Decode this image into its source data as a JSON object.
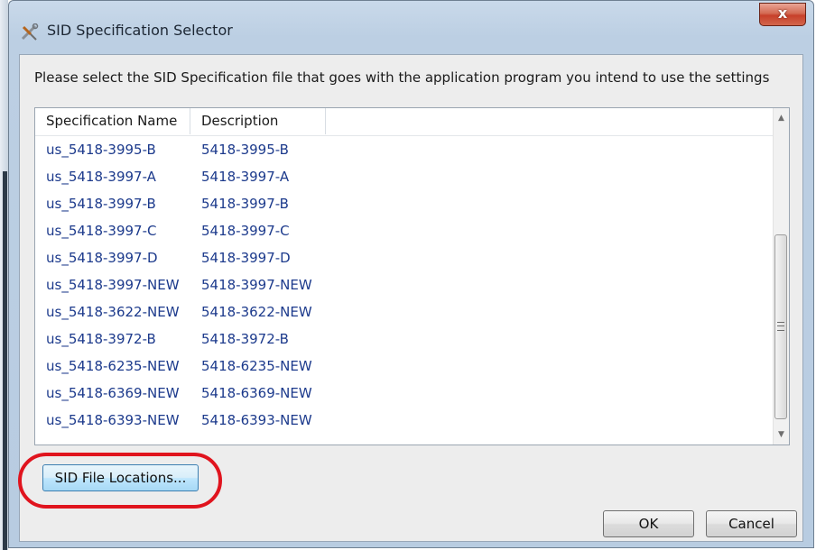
{
  "window": {
    "title": "SID Specification Selector",
    "close_label": "x"
  },
  "instruction": "Please select the SID Specification file that goes with the application program you intend to use the settings",
  "list": {
    "columns": [
      "Specification Name",
      "Description"
    ],
    "rows": [
      {
        "name": "us_5418-3995-B",
        "description": "5418-3995-B"
      },
      {
        "name": "us_5418-3997-A",
        "description": "5418-3997-A"
      },
      {
        "name": "us_5418-3997-B",
        "description": "5418-3997-B"
      },
      {
        "name": "us_5418-3997-C",
        "description": "5418-3997-C"
      },
      {
        "name": "us_5418-3997-D",
        "description": "5418-3997-D"
      },
      {
        "name": "us_5418-3997-NEW",
        "description": "5418-3997-NEW"
      },
      {
        "name": "us_5418-3622-NEW",
        "description": "5418-3622-NEW"
      },
      {
        "name": "us_5418-3972-B",
        "description": "5418-3972-B"
      },
      {
        "name": "us_5418-6235-NEW",
        "description": "5418-6235-NEW"
      },
      {
        "name": "us_5418-6369-NEW",
        "description": "5418-6369-NEW"
      },
      {
        "name": "us_5418-6393-NEW",
        "description": "5418-6393-NEW"
      }
    ]
  },
  "buttons": {
    "locations": "SID File Locations...",
    "ok": "OK",
    "cancel": "Cancel"
  },
  "colors": {
    "row_text": "#1c3a8c",
    "annotation": "#e0141e",
    "close_button": "#c7402a"
  },
  "icons": {
    "app": "tools-icon",
    "scroll_up": "scroll-up-arrow-icon",
    "scroll_down": "scroll-down-arrow-icon"
  }
}
